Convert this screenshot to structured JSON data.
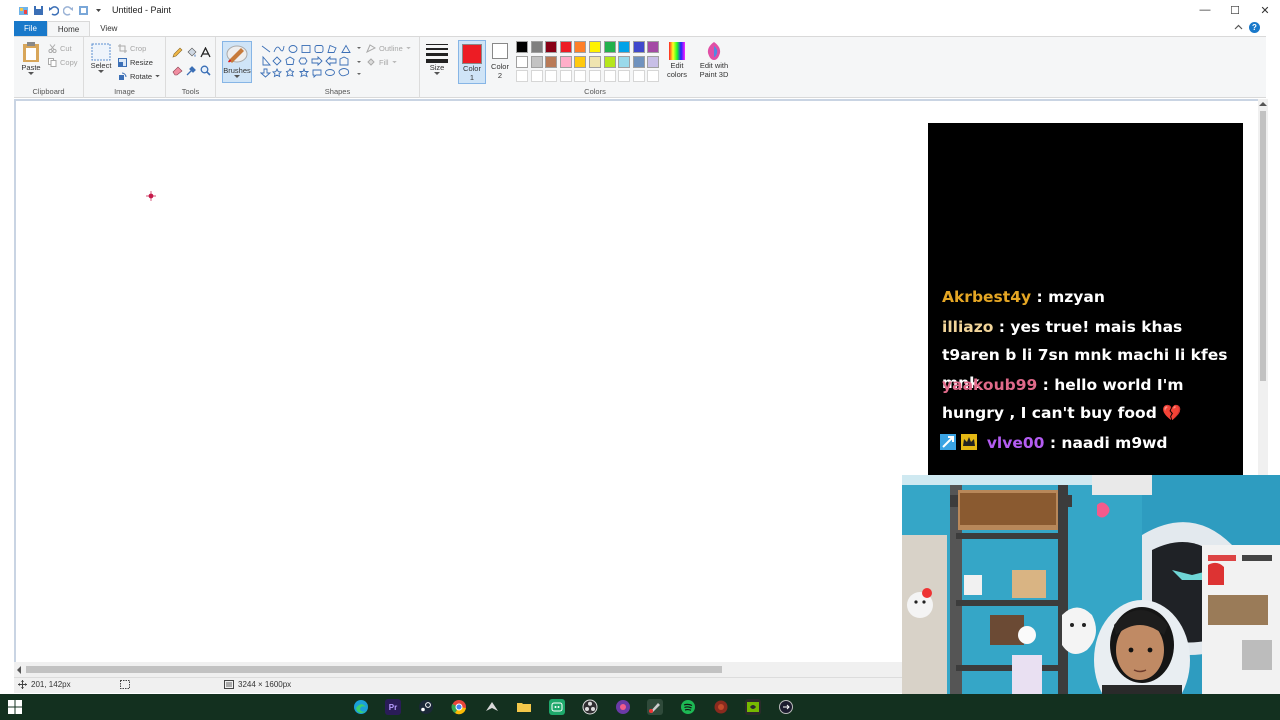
{
  "window": {
    "title": "Untitled - Paint",
    "minimize": "—",
    "maximize": "☐",
    "close": "✕"
  },
  "tabs": {
    "file": "File",
    "home": "Home",
    "view": "View"
  },
  "ribbon": {
    "clipboard": {
      "label": "Clipboard",
      "paste": "Paste",
      "cut": "Cut",
      "copy": "Copy"
    },
    "image": {
      "label": "Image",
      "select": "Select",
      "crop": "Crop",
      "resize": "Resize",
      "rotate": "Rotate"
    },
    "tools": {
      "label": "Tools"
    },
    "brushes": {
      "label": "Brushes"
    },
    "shapes": {
      "label": "Shapes",
      "outline": "Outline",
      "fill": "Fill"
    },
    "size": {
      "label": "Size"
    },
    "colors": {
      "label": "Colors",
      "color1_line1": "Color",
      "color1_line2": "1",
      "color2_line1": "Color",
      "color2_line2": "2",
      "edit_colors_line1": "Edit",
      "edit_colors_line2": "colors",
      "edit_paint3d_line1": "Edit with",
      "edit_paint3d_line2": "Paint 3D",
      "color1_value": "#ed1c24",
      "color2_value": "#ffffff",
      "palette_row1": [
        "#000000",
        "#7f7f7f",
        "#880015",
        "#ed1c24",
        "#ff7f27",
        "#fff200",
        "#22b14c",
        "#00a2e8",
        "#3f48cc",
        "#a349a4"
      ],
      "palette_row2": [
        "#ffffff",
        "#c3c3c3",
        "#b97a57",
        "#ffaec9",
        "#ffc90e",
        "#efe4b0",
        "#b5e61d",
        "#99d9ea",
        "#7092be",
        "#c8bfe7"
      ]
    }
  },
  "status": {
    "cursor_pos": "201, 142px",
    "canvas_size": "3244 × 1600px"
  },
  "chat": {
    "messages": [
      {
        "user": "Akrbest4y",
        "user_color": "#e5a624",
        "sep": " : ",
        "text": "mzyan"
      },
      {
        "user": "illiazo",
        "user_color": "#f2d59a",
        "sep": " : ",
        "text": "yes true! mais khas t9aren b li 7sn mnk machi li kfes mnk"
      },
      {
        "user": "yaakoub99",
        "user_color": "#e06a8a",
        "sep": " : ",
        "text": "hello world I'm hungry , I can't buy food 💔"
      },
      {
        "user": "vlve00",
        "user_color": "#b45cf2",
        "sep": " : ",
        "text": "naadi m9wd"
      }
    ]
  },
  "taskbar": {
    "icons": [
      "windows-start",
      "edge",
      "premiere-pro",
      "steam",
      "chrome",
      "app-5",
      "file-explorer",
      "app-7",
      "obs",
      "app-9",
      "paint",
      "spotify",
      "app-12",
      "nvidia",
      "app-14"
    ]
  }
}
